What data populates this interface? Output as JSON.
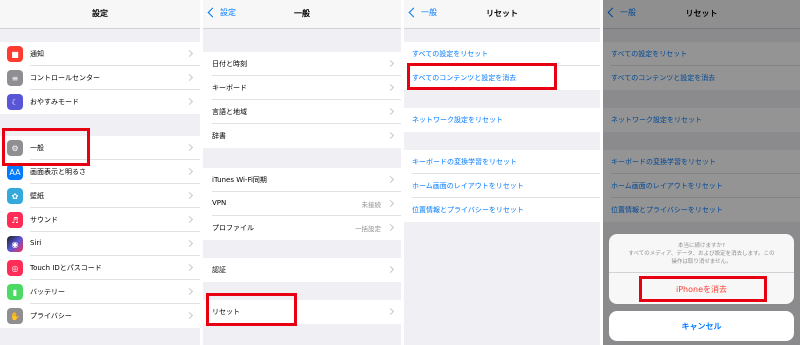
{
  "panel1": {
    "title": "設定",
    "items": [
      {
        "label": "通知",
        "icon": "bell-icon",
        "color": "#ff3b30"
      },
      {
        "label": "コントロールセンター",
        "icon": "toggles-icon",
        "color": "#8e8e93"
      },
      {
        "label": "おやすみモード",
        "icon": "moon-icon",
        "color": "#5856d6"
      },
      {
        "label": "一般",
        "icon": "gear-icon",
        "color": "#8e8e93"
      },
      {
        "label": "画面表示と明るさ",
        "icon": "display-icon",
        "color": "#007aff"
      },
      {
        "label": "壁紙",
        "icon": "wallpaper-icon",
        "color": "#34aadc"
      },
      {
        "label": "サウンド",
        "icon": "speaker-icon",
        "color": "#ff2d55"
      },
      {
        "label": "Siri",
        "icon": "siri-icon",
        "color": "#1c1c1e"
      },
      {
        "label": "Touch IDとパスコード",
        "icon": "fingerprint-icon",
        "color": "#ff2d55"
      },
      {
        "label": "バッテリー",
        "icon": "battery-icon",
        "color": "#4cd964"
      },
      {
        "label": "プライバシー",
        "icon": "hand-icon",
        "color": "#8e8e93"
      }
    ]
  },
  "panel2": {
    "back": "設定",
    "title": "一般",
    "items": [
      {
        "label": "日付と時刻"
      },
      {
        "label": "キーボード"
      },
      {
        "label": "言語と地域"
      },
      {
        "label": "辞書"
      },
      {
        "label": "iTunes Wi-Fi同期"
      },
      {
        "label": "VPN",
        "value": "未接続"
      },
      {
        "label": "プロファイル",
        "value": "一括設定"
      },
      {
        "label": "認証"
      },
      {
        "label": "リセット"
      }
    ]
  },
  "panel3": {
    "back": "一般",
    "title": "リセット",
    "items": [
      {
        "label": "すべての設定をリセット"
      },
      {
        "label": "すべてのコンテンツと設定を消去"
      },
      {
        "label": "ネットワーク設定をリセット"
      },
      {
        "label": "キーボードの変換学習をリセット"
      },
      {
        "label": "ホーム画面のレイアウトをリセット"
      },
      {
        "label": "位置情報とプライバシーをリセット"
      }
    ]
  },
  "panel4": {
    "back": "一般",
    "title": "リセット",
    "items": [
      {
        "label": "すべての設定をリセット"
      },
      {
        "label": "すべてのコンテンツと設定を消去"
      },
      {
        "label": "ネットワーク設定をリセット"
      },
      {
        "label": "キーボードの変換学習をリセット"
      },
      {
        "label": "ホーム画面のレイアウトをリセット"
      },
      {
        "label": "位置情報とプライバシーをリセット"
      }
    ],
    "alert": {
      "line1": "本当に続けますか?",
      "line2": "すべてのメディア、データ、および設定を消去します。この",
      "line3": "操作は取り消せません。",
      "confirm": "iPhoneを消去",
      "cancel": "キャンセル"
    }
  },
  "colors": {
    "accent": "#007aff",
    "highlight": "#e60012",
    "destructive": "#ff3b30"
  }
}
